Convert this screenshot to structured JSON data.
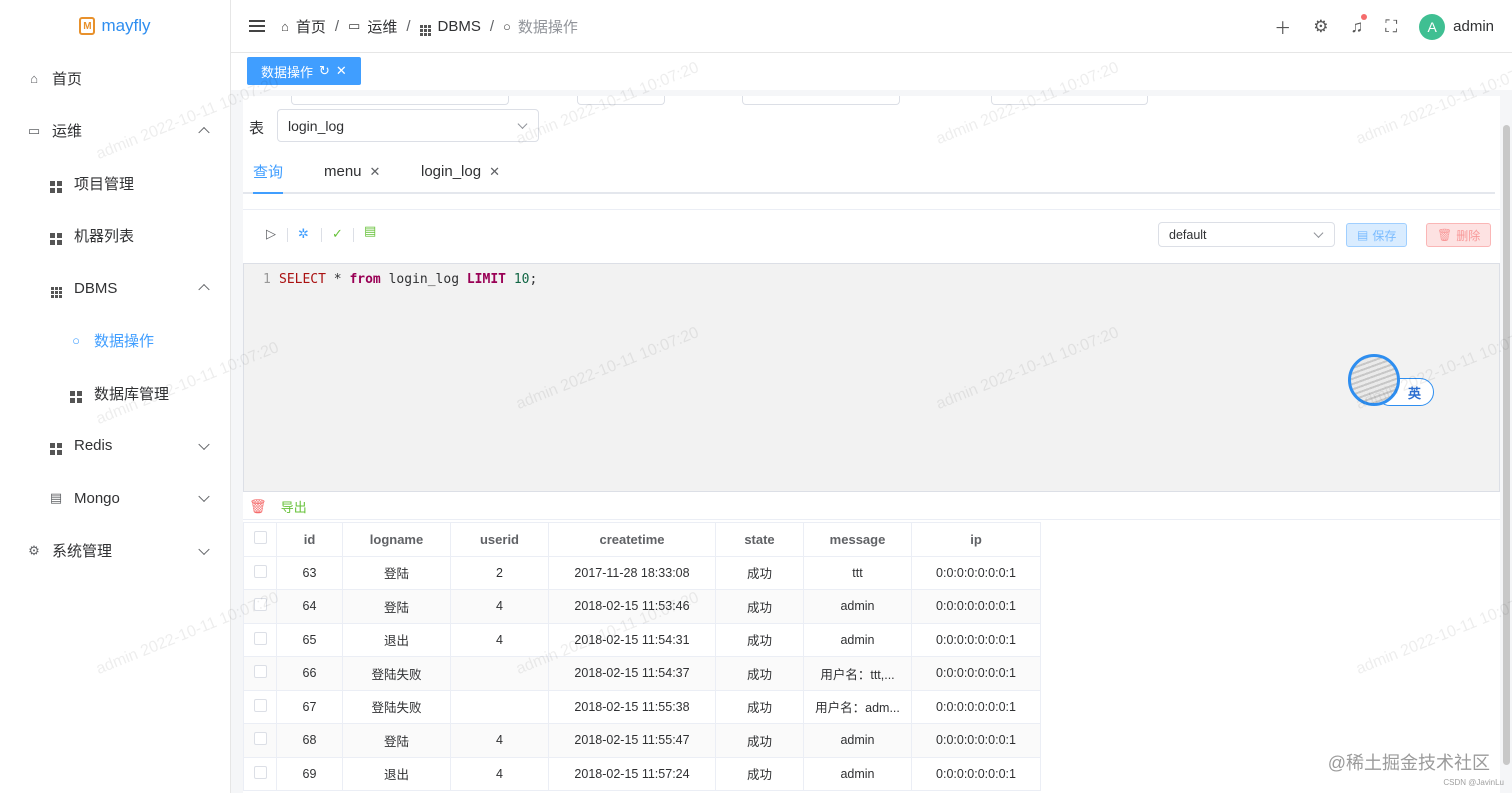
{
  "app": {
    "logo_text": "mayfly"
  },
  "sidebar": {
    "items": [
      {
        "label": "首页"
      },
      {
        "label": "运维"
      },
      {
        "label": "项目管理"
      },
      {
        "label": "机器列表"
      },
      {
        "label": "DBMS"
      },
      {
        "label": "数据操作"
      },
      {
        "label": "数据库管理"
      },
      {
        "label": "Redis"
      },
      {
        "label": "Mongo"
      },
      {
        "label": "系统管理"
      }
    ]
  },
  "header": {
    "breadcrumbs": [
      "首页",
      "运维",
      "DBMS",
      "数据操作"
    ],
    "user_initial": "A",
    "user_name": "admin"
  },
  "tags": {
    "active_label": "数据操作"
  },
  "form": {
    "table_label": "表",
    "table_value": "login_log"
  },
  "query_tabs": [
    {
      "label": "查询"
    },
    {
      "label": "menu"
    },
    {
      "label": "login_log"
    }
  ],
  "toolbar": {
    "snippet_select": "default",
    "save_label": "保存",
    "delete_label": "删除"
  },
  "editor": {
    "line_number": "1",
    "tokens": [
      "SELECT",
      " * ",
      "from",
      " login_log ",
      "LIMIT",
      " ",
      "10",
      ";"
    ]
  },
  "ime": {
    "label": "英"
  },
  "results": {
    "export_label": "导出",
    "columns": [
      "id",
      "logname",
      "userid",
      "createtime",
      "state",
      "message",
      "ip"
    ],
    "rows": [
      [
        "63",
        "登陆",
        "2",
        "2017-11-28 18:33:08",
        "成功",
        "ttt",
        "0:0:0:0:0:0:0:1"
      ],
      [
        "64",
        "登陆",
        "4",
        "2018-02-15 11:53:46",
        "成功",
        "admin",
        "0:0:0:0:0:0:0:1"
      ],
      [
        "65",
        "退出",
        "4",
        "2018-02-15 11:54:31",
        "成功",
        "admin",
        "0:0:0:0:0:0:0:1"
      ],
      [
        "66",
        "登陆失败",
        "",
        "2018-02-15 11:54:37",
        "成功",
        "用户名：ttt,...",
        "0:0:0:0:0:0:0:1"
      ],
      [
        "67",
        "登陆失败",
        "",
        "2018-02-15 11:55:38",
        "成功",
        "用户名：adm...",
        "0:0:0:0:0:0:0:1"
      ],
      [
        "68",
        "登陆",
        "4",
        "2018-02-15 11:55:47",
        "成功",
        "admin",
        "0:0:0:0:0:0:0:1"
      ],
      [
        "69",
        "退出",
        "4",
        "2018-02-15 11:57:24",
        "成功",
        "admin",
        "0:0:0:0:0:0:0:1"
      ]
    ]
  },
  "watermark": {
    "text": "admin 2022-10-11 10:07:20"
  },
  "footer": {
    "site": "@稀土掘金技术社区",
    "author": "CSDN @JavinLu"
  }
}
